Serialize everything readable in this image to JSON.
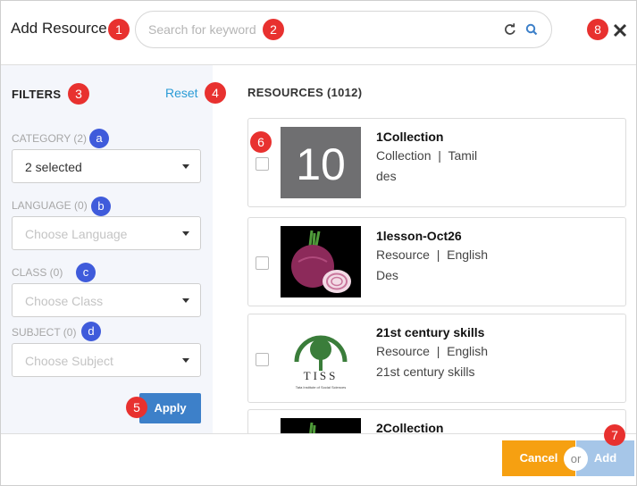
{
  "header": {
    "title": "Add Resource",
    "search_placeholder": "Search for keyword",
    "search_value": "",
    "icons": [
      "refresh-icon",
      "search-icon",
      "close-icon"
    ]
  },
  "filters": {
    "title": "FILTERS",
    "reset_label": "Reset",
    "apply_label": "Apply",
    "items": [
      {
        "label": "CATEGORY (2)",
        "value": "2 selected",
        "placeholder": false
      },
      {
        "label": "LANGUAGE (0)",
        "value": "Choose Language",
        "placeholder": true
      },
      {
        "label": "CLASS (0)",
        "value": "Choose Class",
        "placeholder": true
      },
      {
        "label": "SUBJECT (0)",
        "value": "Choose Subject",
        "placeholder": true
      }
    ]
  },
  "resources": {
    "title": "RESOURCES (1012)",
    "items": [
      {
        "name": "1Collection",
        "type": "Collection",
        "language": "Tamil",
        "description": "des",
        "thumb_text": "10",
        "thumb": "number-tile"
      },
      {
        "name": "1lesson-Oct26",
        "type": "Resource",
        "language": "English",
        "description": "Des",
        "thumb": "onion-image"
      },
      {
        "name": "21st century skills",
        "type": "Resource",
        "language": "English",
        "description": "21st century skills",
        "thumb": "tiss-logo",
        "logo_text": "TISS",
        "logo_caption": "Tata Institute of Social Sciences"
      },
      {
        "name": "2Collection",
        "thumb": "onion-image"
      }
    ]
  },
  "footer": {
    "cancel_label": "Cancel",
    "or_label": "or",
    "add_label": "Add"
  },
  "markers": [
    "1",
    "2",
    "3",
    "4",
    "5",
    "6",
    "7",
    "8",
    "a",
    "b",
    "c",
    "d"
  ],
  "colors": {
    "accent_link": "#2a9bd6",
    "apply": "#3d80c9",
    "cancel": "#f6a011",
    "add_disabled": "#a6c6e8",
    "marker_red": "#e8312f",
    "marker_blue": "#3f5bdb"
  }
}
